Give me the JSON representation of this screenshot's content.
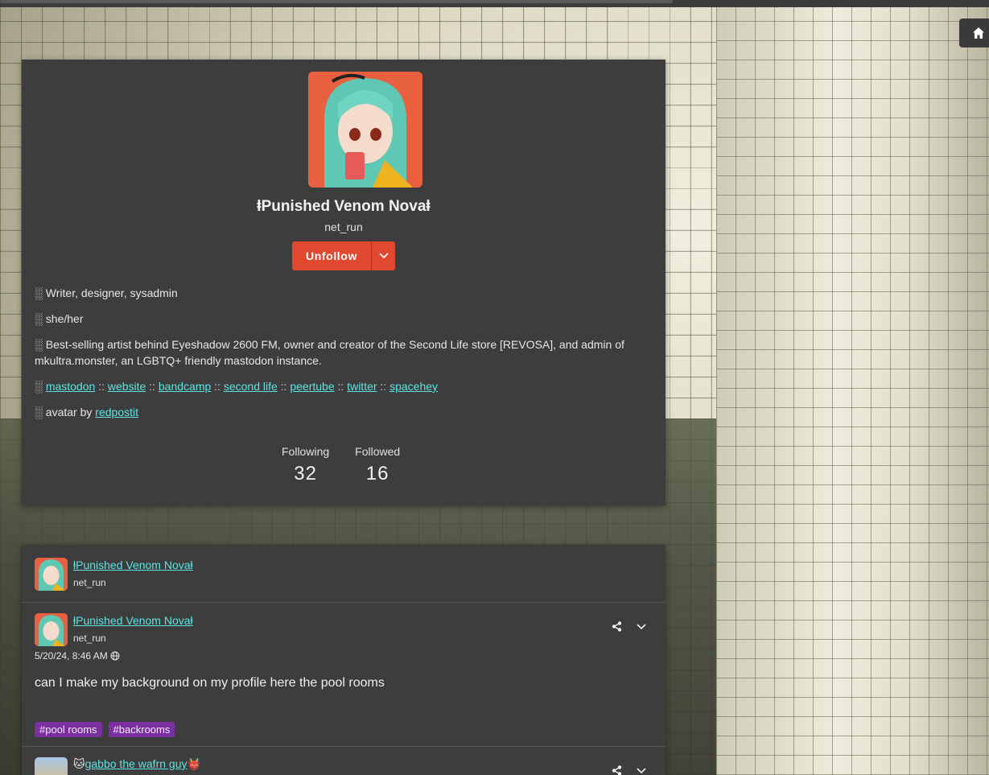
{
  "home_icon": "home-icon",
  "profile": {
    "display_name": "ⱡPunished Venom Novaⱡ",
    "handle": "net_run",
    "unfollow_label": "Unfollow",
    "bio": {
      "line1": "░ Writer, designer, sysadmin",
      "line2": "░ she/her",
      "line3": "░ Best-selling artist behind Eyeshadow 2600 FM, owner and creator of the Second Life store [REVOSA], and admin of mkultra.monster, an LGBTQ+ friendly mastodon instance.",
      "links_prefix": "░ ",
      "links": [
        "mastodon",
        "website",
        "bandcamp",
        "second life",
        "peertube",
        "twitter",
        "spacehey"
      ],
      "separator": "::",
      "avatar_credit_prefix": "░ avatar by ",
      "avatar_credit_link": "redpostit"
    },
    "stats": {
      "following_label": "Following",
      "following_value": "32",
      "followed_label": "Followed",
      "followed_value": "16"
    }
  },
  "post": {
    "reblogger_name": "ⱡPunished Venom Novaⱡ",
    "reblogger_handle": "net_run",
    "author_name": "ⱡPunished Venom Novaⱡ",
    "author_handle": "net_run",
    "timestamp": "5/20/24, 8:46 AM",
    "body": "can I make my background on my profile here the pool rooms",
    "tags": [
      "#pool rooms",
      "#backrooms"
    ]
  },
  "next_post": {
    "author_name": "gabbo the wafrn guy",
    "emoji_left": "🐱",
    "emoji_right": "👹"
  },
  "colors": {
    "accent": "#e0492f",
    "link": "#5ee3e3",
    "tag_bg": "#7b2fa0",
    "card_bg": "#3d3d3d"
  }
}
